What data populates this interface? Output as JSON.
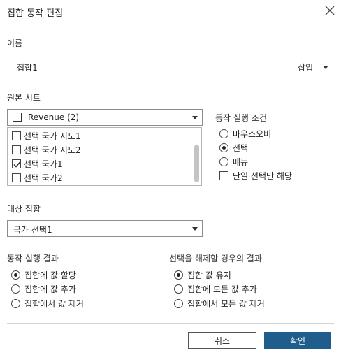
{
  "dialog": {
    "title": "집합 동작 편집",
    "close_icon": "close-icon"
  },
  "name_section": {
    "label": "이름",
    "value": "집합1",
    "insert_label": "삽입"
  },
  "source_sheets": {
    "label": "원본 시트",
    "selected": "Revenue (2)",
    "items": [
      {
        "label": "선택 국가 지도1",
        "checked": false
      },
      {
        "label": "선택 국가 지도2",
        "checked": false
      },
      {
        "label": "선택 국가1",
        "checked": true
      },
      {
        "label": "선택 국가2",
        "checked": false
      }
    ]
  },
  "run_condition": {
    "label": "동작 실행 조건",
    "options": [
      {
        "label": "마우스오버",
        "selected": false
      },
      {
        "label": "선택",
        "selected": true
      },
      {
        "label": "메뉴",
        "selected": false
      }
    ],
    "single_select_label": "단일 선택만 해당",
    "single_select_checked": false
  },
  "target_set": {
    "label": "대상 집합",
    "selected": "국가 선택1"
  },
  "run_result": {
    "label": "동작 실행 결과",
    "options": [
      {
        "label": "집합에 값 할당",
        "selected": true
      },
      {
        "label": "집합에 값 추가",
        "selected": false
      },
      {
        "label": "집합에서 값 제거",
        "selected": false
      }
    ]
  },
  "clear_result": {
    "label": "선택을 해제할 경우의 결과",
    "options": [
      {
        "label": "집합 값 유지",
        "selected": true
      },
      {
        "label": "집합에 모든 값 추가",
        "selected": false
      },
      {
        "label": "집합에서 모든 값 제거",
        "selected": false
      }
    ]
  },
  "footer": {
    "cancel_label": "취소",
    "ok_label": "확인"
  },
  "colors": {
    "primary": "#1f5e8c",
    "border": "#8c8c8c",
    "separator": "#d4d4d4"
  }
}
